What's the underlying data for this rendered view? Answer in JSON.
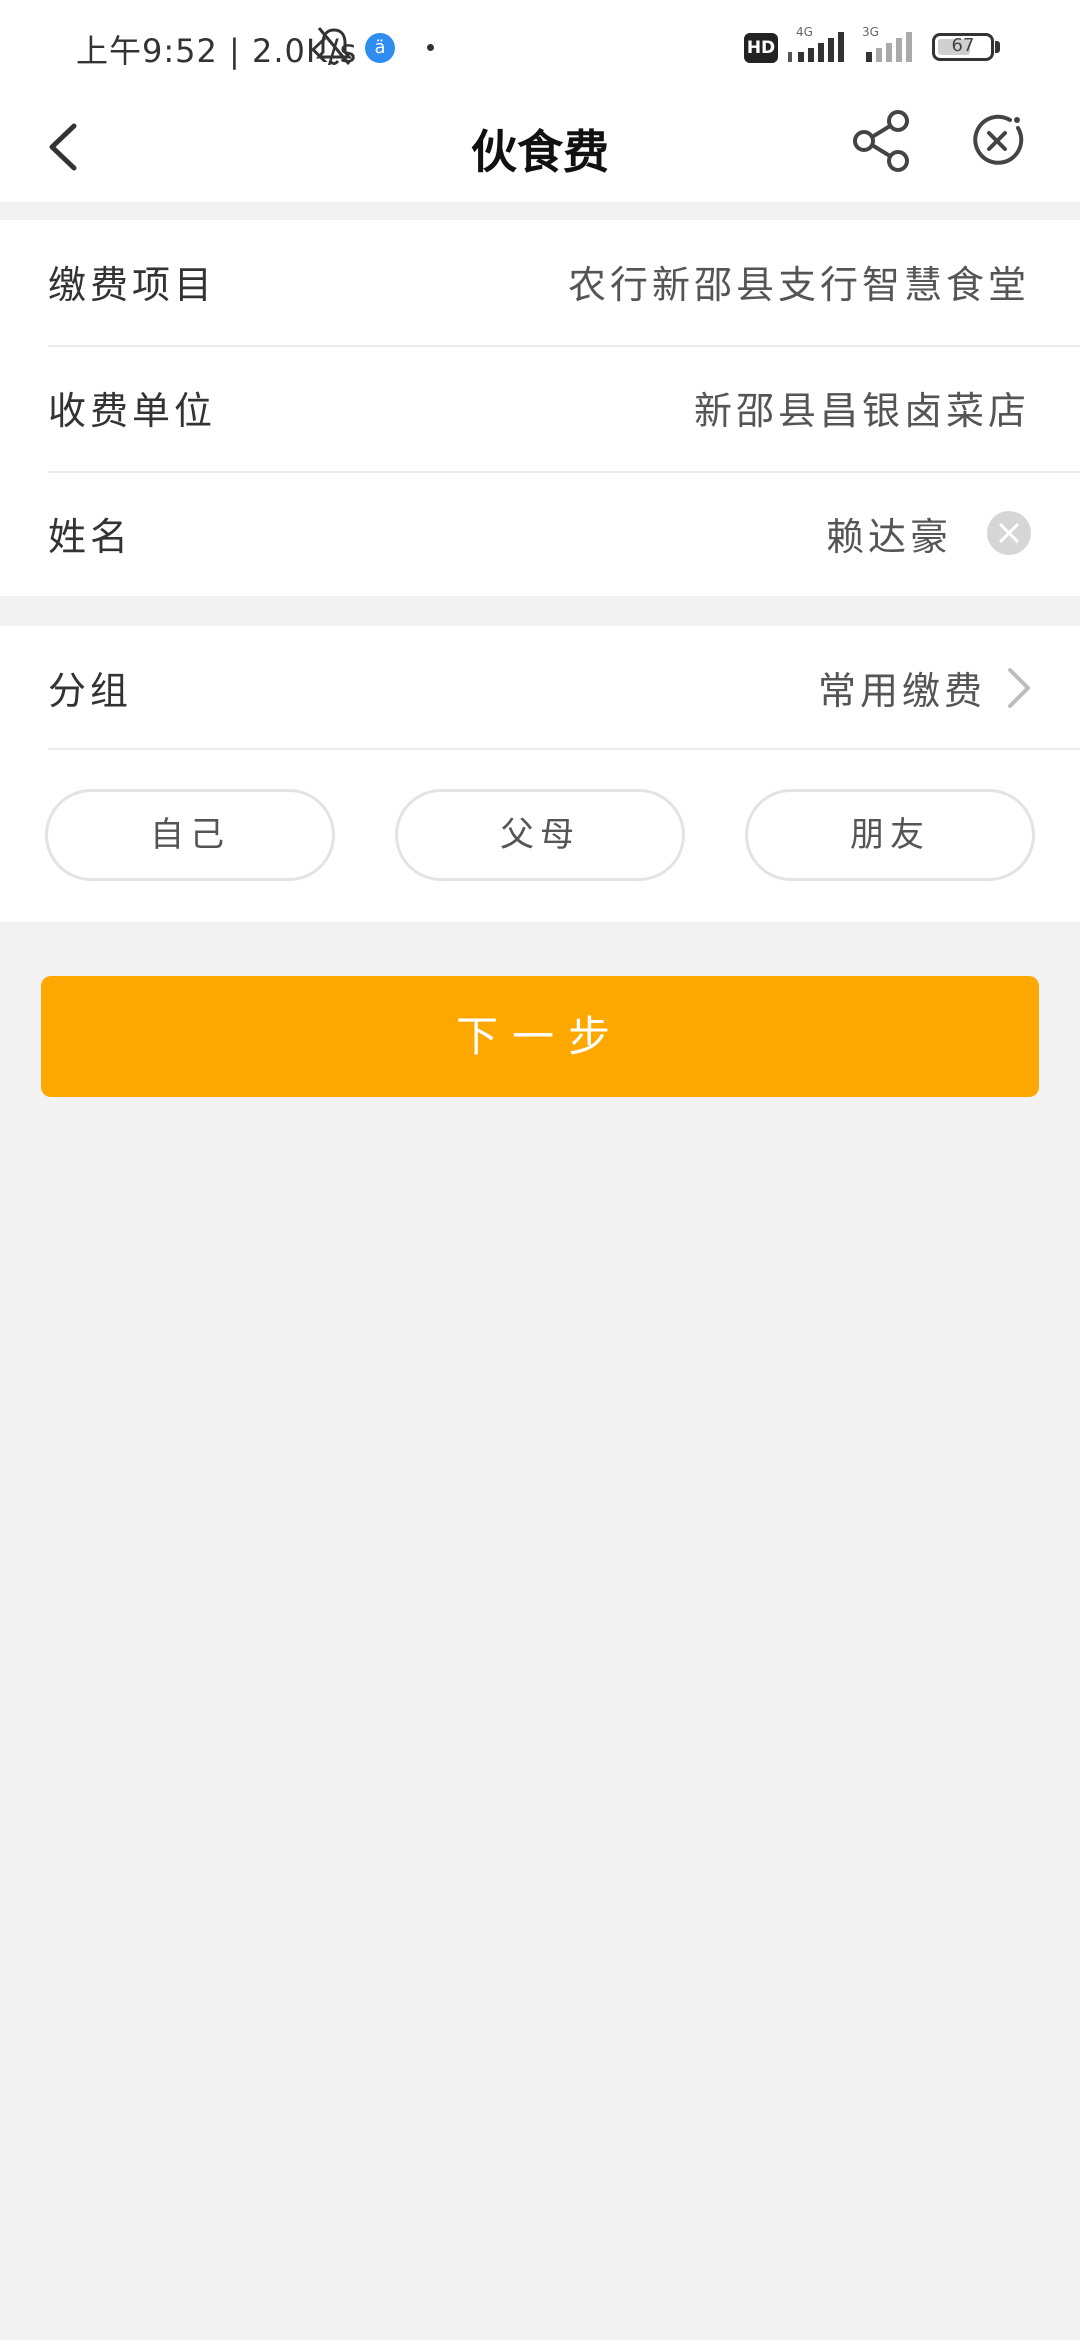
{
  "status_bar": {
    "time_speed": "上午9:52 | 2.0K/s",
    "app_icon_glyph": "ä",
    "hd_label": "HD",
    "signal1_label": "4G",
    "signal2_label": "3G",
    "battery_level": "67",
    "battery_percent": 67
  },
  "nav": {
    "title": "伙食费",
    "back_icon": "chevron-left-icon",
    "share_icon": "share-icon",
    "close_icon": "close-circle-icon"
  },
  "form": {
    "project_label": "缴费项目",
    "project_value": "农行新邵县支行智慧食堂",
    "payee_label": "收费单位",
    "payee_value": "新邵县昌银卤菜店",
    "name_label": "姓名",
    "name_value": "赖达豪",
    "group_label": "分组",
    "group_value": "常用缴费"
  },
  "group_options": [
    "自己",
    "父母",
    "朋友"
  ],
  "next_button_label": "下一步",
  "colors": {
    "accent": "#fda800",
    "background": "#f2f2f2"
  }
}
